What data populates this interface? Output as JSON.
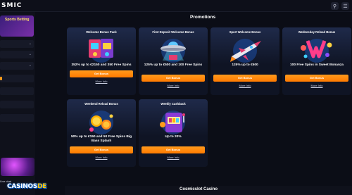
{
  "header": {
    "logo_text": "SMIC"
  },
  "sidebar": {
    "promo_tile_label": "Sports Betting",
    "rows": [
      "",
      "",
      "",
      "",
      "",
      "",
      ""
    ],
    "live_chat": "Live chat"
  },
  "watermark": {
    "text": "CASINOS",
    "dot": "DE"
  },
  "main": {
    "title": "Promotions",
    "cards": [
      {
        "title": "Welcome Bonus Pack",
        "offer": "352% up to €2150 and 350 Free Spins",
        "button": "Get Bonus",
        "more": "More Info"
      },
      {
        "title": "First Deposit Welcome Bonus",
        "offer": "125% up to €500 and 100 Free Spins",
        "button": "Get Bonus",
        "more": "More Info"
      },
      {
        "title": "Sport Welcome Bonus",
        "offer": "125% up to €500",
        "button": "Get Bonus",
        "more": "More Info"
      },
      {
        "title": "Wednesday Reload Bonus",
        "offer": "100 Free Spins in Sweet Bonanza",
        "button": "Get Bonus",
        "more": "More Info"
      },
      {
        "title": "Weekend Reload Bonus",
        "offer": "50% up to €150 and 50 Free Spins Big Bass Splash",
        "button": "Get Bonus",
        "more": "More Info"
      },
      {
        "title": "Weekly Cashback",
        "offer": "Up to 20%",
        "button": "Get Bonus",
        "more": "More Info"
      }
    ],
    "footer_title": "Cosmicslot Casino"
  }
}
